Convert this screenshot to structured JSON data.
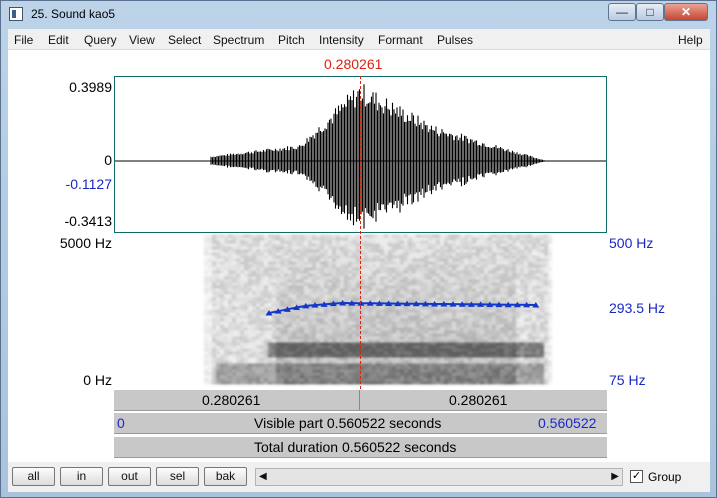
{
  "window": {
    "title": "25. Sound kao5",
    "buttons": {
      "minimize": "—",
      "maximize": "□",
      "close": "✕"
    }
  },
  "menu": [
    "File",
    "Edit",
    "Query",
    "View",
    "Select",
    "Spectrum",
    "Pitch",
    "Intensity",
    "Formant",
    "Pulses"
  ],
  "help": "Help",
  "cursor": {
    "time": "0.280261"
  },
  "waveform": {
    "y_labels": {
      "max": "0.3989",
      "zero": "0",
      "cursor_value": "-0.1127",
      "min": "-0.3413"
    }
  },
  "spectrogram": {
    "left_labels": {
      "top": "5000 Hz",
      "bottom": "0 Hz"
    },
    "right_labels": {
      "top": "500 Hz",
      "pitch": "293.5 Hz",
      "bottom": "75 Hz"
    },
    "pitch_color": "#1338c8"
  },
  "strips": {
    "left_time": "0.280261",
    "right_time": "0.280261",
    "visible_start": "0",
    "visible_text": "Visible part 0.560522 seconds",
    "visible_end": "0.560522",
    "total_text": "Total duration 0.560522 seconds"
  },
  "bottom": {
    "buttons": [
      "all",
      "in",
      "out",
      "sel",
      "bak"
    ],
    "group_label": "Group",
    "group_checked": true
  }
}
